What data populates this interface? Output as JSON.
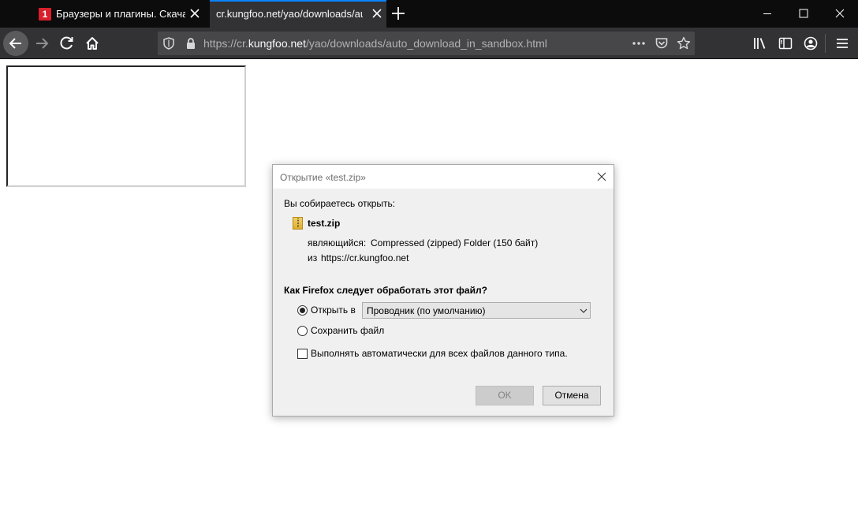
{
  "tabs": [
    {
      "title": "Браузеры и плагины. Скачать",
      "favicon": "1"
    },
    {
      "title": "cr.kungfoo.net/yao/downloads/auto_"
    }
  ],
  "urlbar": {
    "prefix": "https://cr.",
    "host": "kungfoo.net",
    "path": "/yao/downloads/auto_download_in_sandbox.html"
  },
  "dialog": {
    "title": "Открытие «test.zip»",
    "intro": "Вы собираетесь открыть:",
    "filename": "test.zip",
    "type_label": "являющийся:",
    "type_value": "Compressed (zipped) Folder (150 байт)",
    "from_label": "из",
    "from_value": "https://cr.kungfoo.net",
    "question": "Как Firefox следует обработать этот файл?",
    "open_with_label": "Открыть в",
    "open_with_selected": "Проводник (по умолчанию)",
    "save_file_label": "Сохранить файл",
    "auto_label": "Выполнять автоматически для всех файлов данного типа.",
    "ok_label": "OK",
    "cancel_label": "Отмена"
  },
  "colors": {
    "tabstrip": "#0c0c0d",
    "toolbar": "#323234",
    "accent": "#0a84ff"
  }
}
